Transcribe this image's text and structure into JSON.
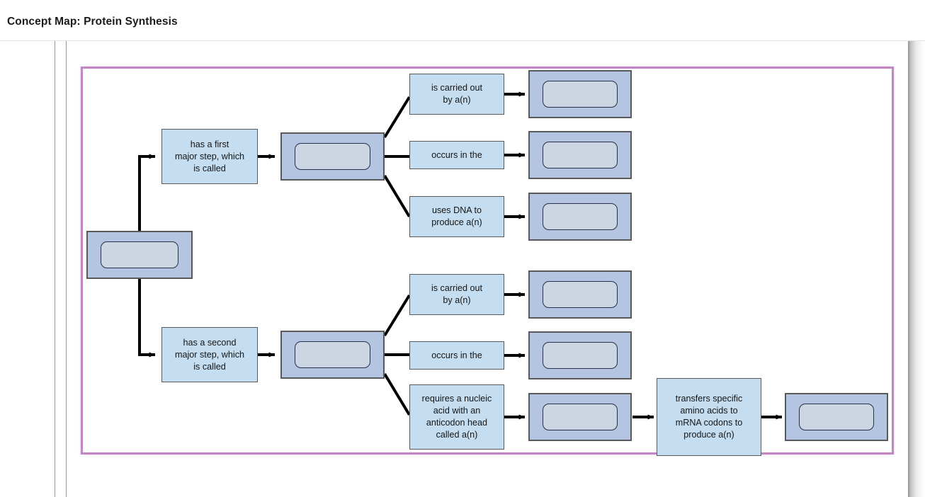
{
  "header": {
    "title": "Concept Map: Protein Synthesis"
  },
  "colors": {
    "frame_border": "#c087c4",
    "label_fill": "#c4ddf0",
    "concept_fill": "#b3c5e0",
    "slot_fill": "#ccd5e2",
    "connector": "#000000",
    "guide_line": "#9a9a9a",
    "page_background": "#ffffff"
  },
  "diagram": {
    "type": "concept-map",
    "root": {
      "id": "root-concept",
      "name": "root-concept-slot",
      "text": "",
      "filled": false
    },
    "branches": [
      {
        "id": "branch-first-step",
        "link_label": "has a first major step, which is called",
        "concept": {
          "id": "concept-first-step",
          "text": "",
          "filled": false
        },
        "children": [
          {
            "id": "first-carried-out-by",
            "link_label": "is carried out by a(n)",
            "concept": {
              "id": "concept-first-agent",
              "text": "",
              "filled": false
            }
          },
          {
            "id": "first-occurs-in",
            "link_label": "occurs in the",
            "concept": {
              "id": "concept-first-location",
              "text": "",
              "filled": false
            }
          },
          {
            "id": "first-uses-dna",
            "link_label": "uses DNA to produce a(n)",
            "concept": {
              "id": "concept-first-product",
              "text": "",
              "filled": false
            }
          }
        ]
      },
      {
        "id": "branch-second-step",
        "link_label": "has a second major step, which is called",
        "concept": {
          "id": "concept-second-step",
          "text": "",
          "filled": false
        },
        "children": [
          {
            "id": "second-carried-out-by",
            "link_label": "is carried out by a(n)",
            "concept": {
              "id": "concept-second-agent",
              "text": "",
              "filled": false
            }
          },
          {
            "id": "second-occurs-in",
            "link_label": "occurs in the",
            "concept": {
              "id": "concept-second-location",
              "text": "",
              "filled": false
            }
          },
          {
            "id": "second-requires-trna",
            "link_label": "requires a nucleic acid with an anticodon head called a(n)",
            "concept": {
              "id": "concept-trna",
              "text": "",
              "filled": false
            },
            "next": {
              "id": "trna-transfers",
              "link_label": "transfers specific amino acids to mRNA codons to produce a(n)",
              "concept": {
                "id": "concept-protein",
                "text": "",
                "filled": false
              }
            }
          }
        ]
      }
    ]
  },
  "labels": {
    "l_first_step": "has a first major step, which is called",
    "l_second_step": "has a second major step, which is called",
    "l_carried_out_1": "is carried out by a(n)",
    "l_occurs_in_1": "occurs in the",
    "l_uses_dna": "uses DNA to produce a(n)",
    "l_carried_out_2": "is carried out by a(n)",
    "l_occurs_in_2": "occurs in the",
    "l_requires_trna": "requires a nucleic acid with an anticodon head called a(n)",
    "l_transfers": "transfers specific amino acids to mRNA codons to produce a(n)"
  },
  "label_lines": {
    "l_first_step": [
      "has a first",
      "major step, which",
      "is called"
    ],
    "l_second_step": [
      "has a second",
      "major step, which",
      "is called"
    ],
    "l_carried_out_1": [
      "is carried out",
      "by a(n)"
    ],
    "l_occurs_in_1": [
      "occurs in the"
    ],
    "l_uses_dna": [
      "uses DNA to",
      "produce a(n)"
    ],
    "l_carried_out_2": [
      "is carried out",
      "by a(n)"
    ],
    "l_occurs_in_2": [
      "occurs in the"
    ],
    "l_requires_trna": [
      "requires a nucleic",
      "acid with an",
      "anticodon head",
      "called a(n)"
    ],
    "l_transfers": [
      "transfers specific",
      "amino acids to",
      "mRNA codons to",
      "produce a(n)"
    ]
  }
}
